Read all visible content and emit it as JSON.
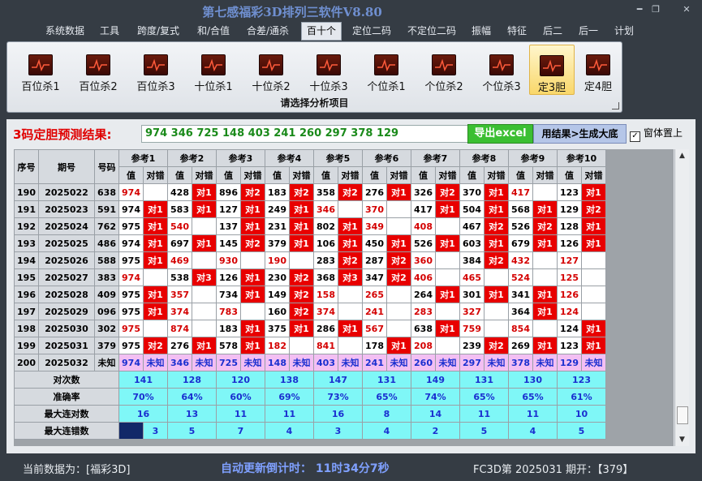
{
  "window": {
    "title": "第七感福彩3D排列三软件V8.80",
    "min": "━",
    "max": "❐",
    "close": "✕"
  },
  "menu": [
    "系统数据",
    "工具",
    "跨度/复式",
    "和/合值",
    "合差/通杀",
    "百十个",
    "定位二码",
    "不定位二码",
    "振幅",
    "特征",
    "后二",
    "后一",
    "计划"
  ],
  "ribbon": {
    "buttons": [
      "百位杀1",
      "百位杀2",
      "百位杀3",
      "十位杀1",
      "十位杀2",
      "十位杀3",
      "个位杀1",
      "个位杀2",
      "个位杀3",
      "定3胆",
      "定4胆"
    ],
    "active_index": 9,
    "footer": "请选择分析项目"
  },
  "prediction": {
    "label": "3码定胆预测结果:",
    "value": "974  346  725  148  403  241  260  297  378  129",
    "export_button": "导出excel",
    "generate_button": "用结果>生成大底",
    "topmost_label": "窗体置上",
    "topmost_checked": true
  },
  "table": {
    "headers": {
      "seq": "序号",
      "period": "期号",
      "number": "号码",
      "value": "值",
      "check": "对错"
    },
    "groups": [
      "参考1",
      "参考2",
      "参考3",
      "参考4",
      "参考5",
      "参考6",
      "参考7",
      "参考8",
      "参考9",
      "参考10"
    ],
    "rows": [
      {
        "seq": "190",
        "period": "2025022",
        "num": "638",
        "cells": [
          [
            "974",
            "m",
            ""
          ],
          [
            "428",
            "v",
            "对1"
          ],
          [
            "896",
            "v",
            "对2"
          ],
          [
            "183",
            "v",
            "对2"
          ],
          [
            "358",
            "v",
            "对2"
          ],
          [
            "276",
            "v",
            "对1"
          ],
          [
            "326",
            "v",
            "对2"
          ],
          [
            "370",
            "v",
            "对1"
          ],
          [
            "417",
            "m",
            ""
          ],
          [
            "123",
            "v",
            "对1"
          ]
        ]
      },
      {
        "seq": "191",
        "period": "2025023",
        "num": "591",
        "cells": [
          [
            "974",
            "v",
            "对1"
          ],
          [
            "583",
            "v",
            "对1"
          ],
          [
            "127",
            "v",
            "对1"
          ],
          [
            "249",
            "v",
            "对1"
          ],
          [
            "346",
            "m",
            ""
          ],
          [
            "370",
            "m",
            ""
          ],
          [
            "417",
            "v",
            "对1"
          ],
          [
            "504",
            "v",
            "对1"
          ],
          [
            "568",
            "v",
            "对1"
          ],
          [
            "129",
            "v",
            "对2"
          ]
        ]
      },
      {
        "seq": "192",
        "period": "2025024",
        "num": "762",
        "cells": [
          [
            "975",
            "v",
            "对1"
          ],
          [
            "540",
            "m",
            ""
          ],
          [
            "137",
            "v",
            "对1"
          ],
          [
            "231",
            "v",
            "对1"
          ],
          [
            "802",
            "v",
            "对1"
          ],
          [
            "349",
            "m",
            ""
          ],
          [
            "408",
            "m",
            ""
          ],
          [
            "467",
            "v",
            "对2"
          ],
          [
            "526",
            "v",
            "对2"
          ],
          [
            "128",
            "v",
            "对1"
          ]
        ]
      },
      {
        "seq": "193",
        "period": "2025025",
        "num": "486",
        "cells": [
          [
            "974",
            "v",
            "对1"
          ],
          [
            "697",
            "v",
            "对1"
          ],
          [
            "145",
            "v",
            "对2"
          ],
          [
            "379",
            "v",
            "对1"
          ],
          [
            "106",
            "v",
            "对1"
          ],
          [
            "450",
            "v",
            "对1"
          ],
          [
            "526",
            "v",
            "对1"
          ],
          [
            "603",
            "v",
            "对1"
          ],
          [
            "679",
            "v",
            "对1"
          ],
          [
            "126",
            "v",
            "对1"
          ]
        ]
      },
      {
        "seq": "194",
        "period": "2025026",
        "num": "588",
        "cells": [
          [
            "975",
            "v",
            "对1"
          ],
          [
            "469",
            "m",
            ""
          ],
          [
            "930",
            "m",
            ""
          ],
          [
            "190",
            "m",
            ""
          ],
          [
            "283",
            "v",
            "对2"
          ],
          [
            "287",
            "v",
            "对2"
          ],
          [
            "360",
            "m",
            ""
          ],
          [
            "384",
            "v",
            "对2"
          ],
          [
            "432",
            "m",
            ""
          ],
          [
            "127",
            "m",
            ""
          ]
        ]
      },
      {
        "seq": "195",
        "period": "2025027",
        "num": "383",
        "cells": [
          [
            "974",
            "m",
            ""
          ],
          [
            "538",
            "v",
            "对3"
          ],
          [
            "126",
            "v",
            "对1"
          ],
          [
            "230",
            "v",
            "对2"
          ],
          [
            "368",
            "v",
            "对3"
          ],
          [
            "347",
            "v",
            "对2"
          ],
          [
            "406",
            "m",
            ""
          ],
          [
            "465",
            "m",
            ""
          ],
          [
            "524",
            "m",
            ""
          ],
          [
            "125",
            "m",
            ""
          ]
        ]
      },
      {
        "seq": "196",
        "period": "2025028",
        "num": "409",
        "cells": [
          [
            "975",
            "v",
            "对1"
          ],
          [
            "357",
            "m",
            ""
          ],
          [
            "734",
            "v",
            "对1"
          ],
          [
            "149",
            "v",
            "对2"
          ],
          [
            "158",
            "m",
            ""
          ],
          [
            "265",
            "m",
            ""
          ],
          [
            "264",
            "v",
            "对1"
          ],
          [
            "301",
            "v",
            "对1"
          ],
          [
            "341",
            "v",
            "对1"
          ],
          [
            "126",
            "m",
            ""
          ]
        ]
      },
      {
        "seq": "197",
        "period": "2025029",
        "num": "096",
        "cells": [
          [
            "975",
            "v",
            "对1"
          ],
          [
            "374",
            "m",
            ""
          ],
          [
            "783",
            "m",
            ""
          ],
          [
            "160",
            "v",
            "对2"
          ],
          [
            "374",
            "m",
            ""
          ],
          [
            "241",
            "m",
            ""
          ],
          [
            "283",
            "m",
            ""
          ],
          [
            "327",
            "m",
            ""
          ],
          [
            "364",
            "v",
            "对1"
          ],
          [
            "124",
            "m",
            ""
          ]
        ]
      },
      {
        "seq": "198",
        "period": "2025030",
        "num": "302",
        "cells": [
          [
            "975",
            "m",
            ""
          ],
          [
            "874",
            "m",
            ""
          ],
          [
            "183",
            "v",
            "对1"
          ],
          [
            "375",
            "v",
            "对1"
          ],
          [
            "286",
            "v",
            "对1"
          ],
          [
            "567",
            "m",
            ""
          ],
          [
            "638",
            "v",
            "对1"
          ],
          [
            "759",
            "m",
            ""
          ],
          [
            "854",
            "m",
            ""
          ],
          [
            "124",
            "v",
            "对1"
          ]
        ]
      },
      {
        "seq": "199",
        "period": "2025031",
        "num": "379",
        "cells": [
          [
            "975",
            "v",
            "对2"
          ],
          [
            "276",
            "v",
            "对1"
          ],
          [
            "578",
            "v",
            "对1"
          ],
          [
            "182",
            "m",
            ""
          ],
          [
            "841",
            "m",
            ""
          ],
          [
            "178",
            "v",
            "对1"
          ],
          [
            "208",
            "m",
            ""
          ],
          [
            "239",
            "v",
            "对2"
          ],
          [
            "269",
            "v",
            "对1"
          ],
          [
            "123",
            "v",
            "对1"
          ]
        ]
      }
    ],
    "pred_row": {
      "seq": "200",
      "period": "2025032",
      "num": "未知",
      "values": [
        "974",
        "346",
        "725",
        "148",
        "403",
        "241",
        "260",
        "297",
        "378",
        "129"
      ],
      "unknown": "未知"
    },
    "summary": [
      {
        "label": "对次数",
        "values": [
          "141",
          "128",
          "120",
          "138",
          "147",
          "131",
          "149",
          "131",
          "130",
          "123"
        ]
      },
      {
        "label": "准确率",
        "values": [
          "70%",
          "64%",
          "60%",
          "69%",
          "73%",
          "65%",
          "74%",
          "65%",
          "65%",
          "61%"
        ]
      },
      {
        "label": "最大连对数",
        "values": [
          "16",
          "13",
          "11",
          "11",
          "16",
          "8",
          "14",
          "11",
          "11",
          "10"
        ]
      },
      {
        "label": "最大连错数",
        "values": [
          "3",
          "5",
          "7",
          "4",
          "3",
          "4",
          "2",
          "5",
          "4",
          "5"
        ]
      }
    ]
  },
  "status": {
    "data_source": "当前数据为：[福彩3D]",
    "countdown": "自动更新倒计时：  11时34分7秒",
    "next_draw": "FC3D第 2025031 期开：【379】"
  }
}
